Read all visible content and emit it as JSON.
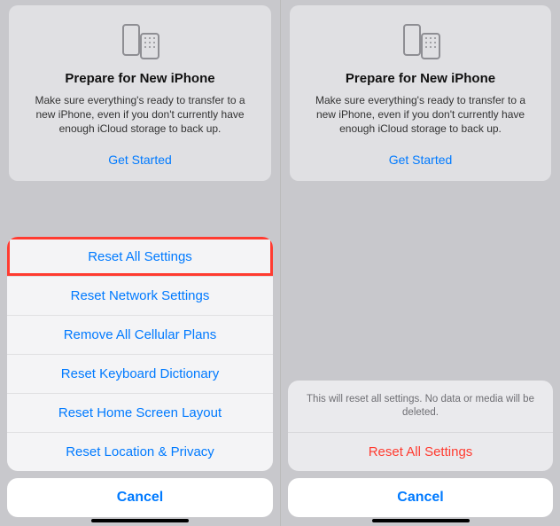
{
  "prepare": {
    "title": "Prepare for New iPhone",
    "desc": "Make sure everything's ready to transfer to a new iPhone, even if you don't currently have enough iCloud storage to back up.",
    "get_started": "Get Started"
  },
  "reset_sheet": {
    "items": [
      "Reset All Settings",
      "Reset Network Settings",
      "Remove All Cellular Plans",
      "Reset Keyboard Dictionary",
      "Reset Home Screen Layout",
      "Reset Location & Privacy"
    ],
    "cancel": "Cancel"
  },
  "confirm_sheet": {
    "message": "This will reset all settings. No data or media will be deleted.",
    "action": "Reset All Settings",
    "cancel": "Cancel"
  },
  "colors": {
    "accent": "#007aff",
    "destructive": "#ff3b30",
    "highlight_border": "#ff3b30"
  }
}
